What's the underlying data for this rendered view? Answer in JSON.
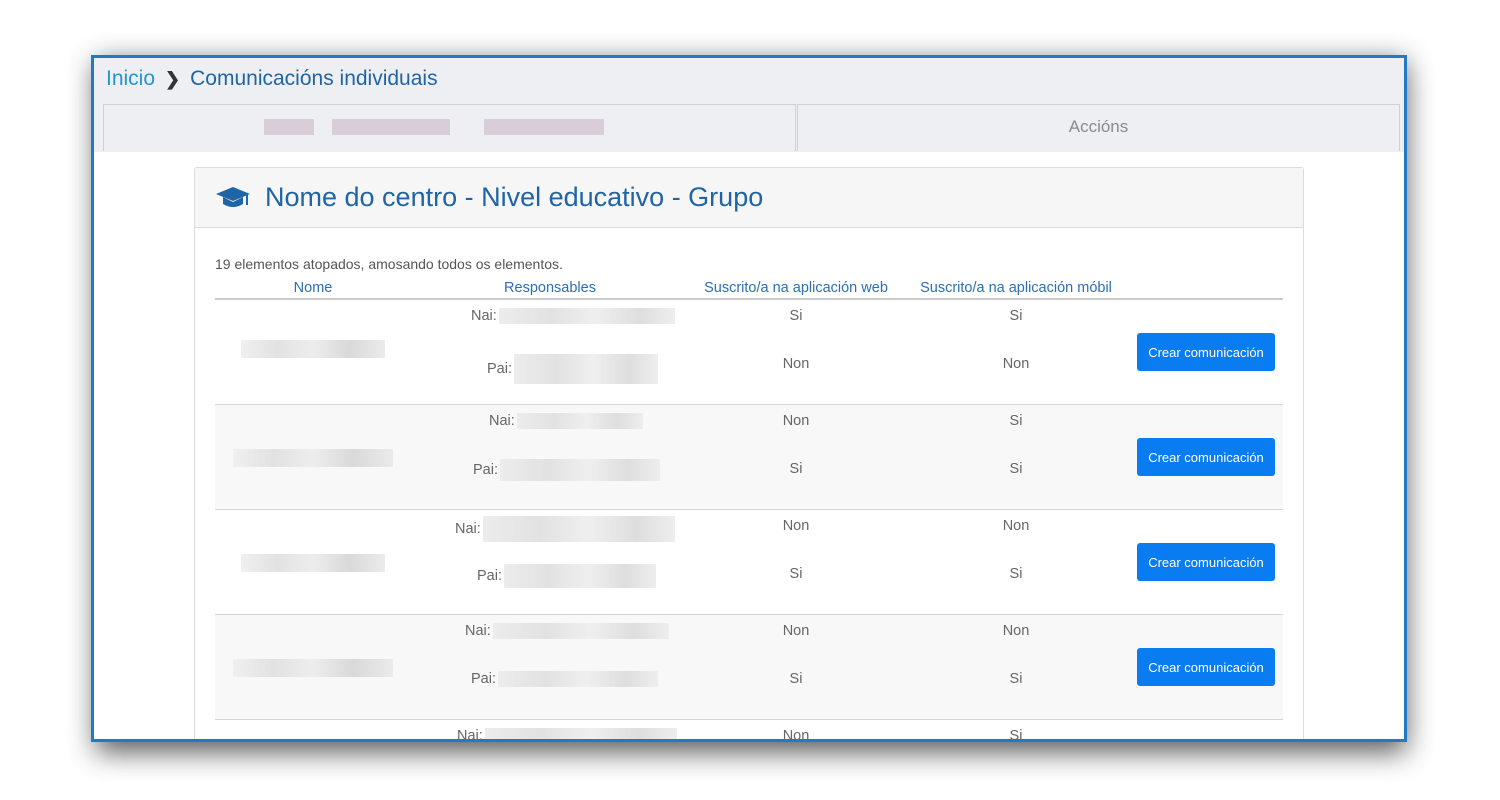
{
  "breadcrumb": {
    "home": "Inicio",
    "current": "Comunicacións individuais"
  },
  "tabs": {
    "actions": "Accións"
  },
  "panel": {
    "title": "Nome do centro - Nivel educativo - Grupo",
    "icon": "graduation-cap-icon",
    "count_text": "19 elementos atopados, amosando todos os elementos."
  },
  "table": {
    "headers": [
      "Nome",
      "Responsables",
      "Suscrito/a na aplicación web",
      "Suscrito/a na aplicación móbil",
      ""
    ],
    "rows": [
      {
        "nai_label": "Nai:",
        "pai_label": "Pai:",
        "web": [
          "Si",
          "Non"
        ],
        "mobile": [
          "Si",
          "Non"
        ],
        "action": "Crear comunicación"
      },
      {
        "nai_label": "Nai:",
        "pai_label": "Pai:",
        "web": [
          "Non",
          "Si"
        ],
        "mobile": [
          "Si",
          "Si"
        ],
        "action": "Crear comunicación"
      },
      {
        "nai_label": "Nai:",
        "pai_label": "Pai:",
        "web": [
          "Non",
          "Si"
        ],
        "mobile": [
          "Non",
          "Si"
        ],
        "action": "Crear comunicación"
      },
      {
        "nai_label": "Nai:",
        "pai_label": "Pai:",
        "web": [
          "Non",
          "Si"
        ],
        "mobile": [
          "Non",
          "Si"
        ],
        "action": "Crear comunicación"
      },
      {
        "nai_label": "Nai:",
        "pai_label": "",
        "web": [
          "Non",
          ""
        ],
        "mobile": [
          "Si",
          ""
        ],
        "action": ""
      }
    ]
  },
  "colors": {
    "accent": "#1f64a5",
    "button": "#0a7cf2",
    "frame": "#1f7bc8"
  }
}
